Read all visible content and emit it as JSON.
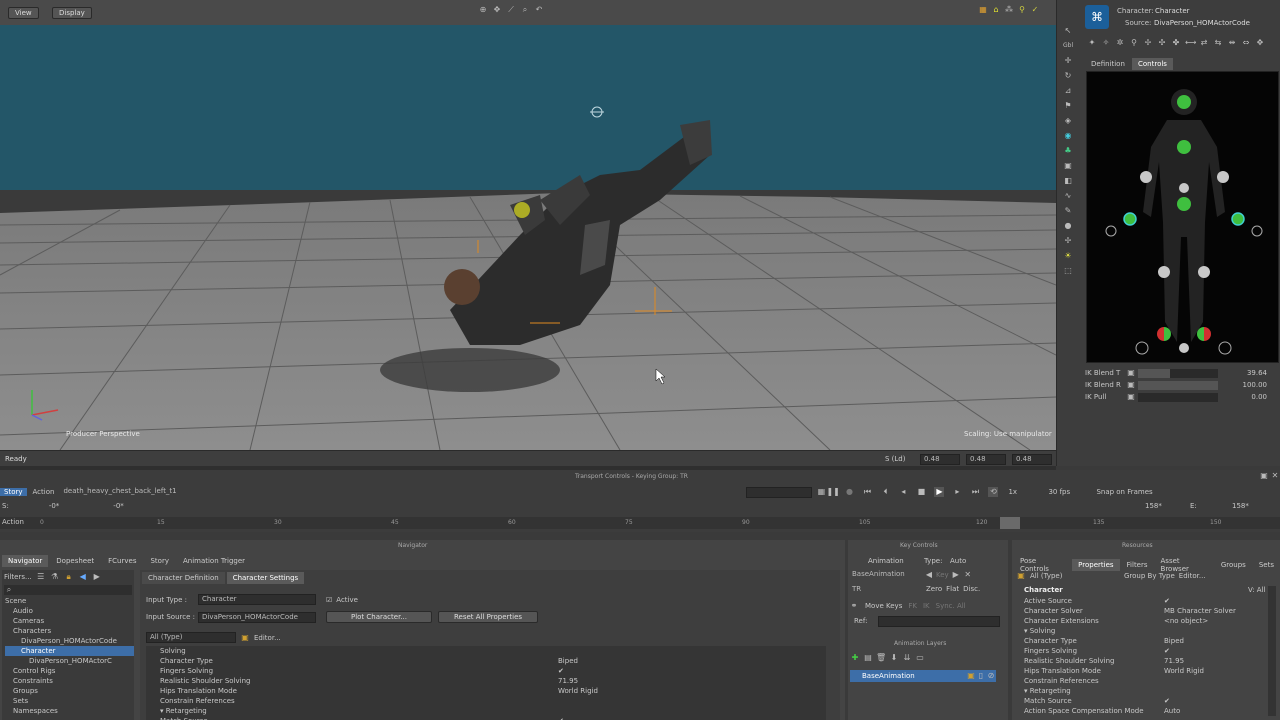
{
  "viewer": {
    "menu_view": "View",
    "menu_display": "Display",
    "label_producer": "Producer Perspective",
    "label_scaling": "Scaling: Use manipulator",
    "status_ready": "Ready",
    "status_coords": "S (Ld)",
    "coord_a": "0.48",
    "coord_b": "0.48",
    "coord_c": "0.48"
  },
  "character_panel": {
    "character_label": "Character:",
    "character_value": "Character",
    "source_label": "Source:",
    "source_value": "DivaPerson_HOMActorCode",
    "tab_definition": "Definition",
    "tab_controls": "Controls",
    "ik_rows": [
      {
        "label": "IK Blend T",
        "value": "39.64",
        "fill": 0.4
      },
      {
        "label": "IK Blend R",
        "value": "100.00",
        "fill": 1.0
      },
      {
        "label": "IK Pull",
        "value": "0.00",
        "fill": 0.0
      }
    ]
  },
  "transport": {
    "title": "Transport Controls  -  Keying Group: TR",
    "story": "Story",
    "action": "Action",
    "take": "death_heavy_chest_back_left_t1",
    "speed": "1x",
    "fps": "30 fps",
    "snap": "Snap on Frames",
    "start_label": "S:",
    "start_value": "-0*",
    "start_value2": "-0*",
    "end_label": "E:",
    "end_value": "158*",
    "end_value_left": "158*",
    "action_label": "Action",
    "ticks": [
      "0",
      "15",
      "30",
      "45",
      "60",
      "75",
      "90",
      "105",
      "120",
      "135",
      "150"
    ]
  },
  "navigator": {
    "title": "Navigator",
    "tabs": [
      "Navigator",
      "Dopesheet",
      "FCurves",
      "Story",
      "Animation Trigger"
    ],
    "filters": "Filters...",
    "tree": [
      {
        "label": "Scene",
        "indent": 0
      },
      {
        "label": "Audio",
        "indent": 1
      },
      {
        "label": "Cameras",
        "indent": 1
      },
      {
        "label": "Characters",
        "indent": 1
      },
      {
        "label": "DivaPerson_HOMActorCode",
        "indent": 2
      },
      {
        "label": "Character",
        "indent": 2
      },
      {
        "label": "DivaPerson_HOMActorC",
        "indent": 3
      },
      {
        "label": "Control Rigs",
        "indent": 1
      },
      {
        "label": "Constraints",
        "indent": 1
      },
      {
        "label": "Groups",
        "indent": 1
      },
      {
        "label": "Sets",
        "indent": 1
      },
      {
        "label": "Namespaces",
        "indent": 1
      }
    ],
    "subtabs": [
      "Character Definition",
      "Character Settings"
    ],
    "input_type_label": "Input Type :",
    "input_type_value": "Character",
    "active_label": "Active",
    "input_source_label": "Input Source :",
    "input_source_value": "DivaPerson_HOMActorCode",
    "plot_button": "Plot Character...",
    "reset_button": "Reset All Properties",
    "all_type": "All (Type)",
    "editor": "Editor...",
    "props": [
      {
        "name": "Solving",
        "value": ""
      },
      {
        "name": "Character Type",
        "value": "Biped"
      },
      {
        "name": "Fingers Solving",
        "value": "✔"
      },
      {
        "name": "Realistic Shoulder Solving",
        "value": "71.95"
      },
      {
        "name": "Hips Translation Mode",
        "value": "World Rigid"
      },
      {
        "name": "Constrain References",
        "value": ""
      },
      {
        "name": "▾ Retargeting",
        "value": ""
      },
      {
        "name": "Match Source",
        "value": "✔"
      }
    ]
  },
  "key_controls": {
    "title": "Key Controls",
    "tab_animation": "Animation",
    "type_label": "Type:",
    "type_value": "Auto",
    "layer": "BaseAnimation",
    "key_label": "Key",
    "tr": "TR",
    "zero": "Zero",
    "flat": "Flat",
    "disc": "Disc.",
    "move_keys": "Move Keys",
    "fk": "FK",
    "ik": "IK",
    "sync_all": "Sync. All",
    "ref": "Ref:",
    "layers_title": "Animation Layers",
    "base_layer": "BaseAnimation"
  },
  "resources": {
    "title": "Resources",
    "tabs": [
      "Pose Controls",
      "Properties",
      "Filters",
      "Asset Browser",
      "Groups",
      "Sets"
    ],
    "all_type": "All (Type)",
    "group_by": "Group By Type",
    "editor": "Editor...",
    "v_all": "V: All",
    "header": "Character",
    "props": [
      {
        "name": "Active Source",
        "value": "✔"
      },
      {
        "name": "Character Solver",
        "value": "MB Character Solver"
      },
      {
        "name": "Character Extensions",
        "value": "<no object>"
      },
      {
        "name": "▾ Solving",
        "value": ""
      },
      {
        "name": "Character Type",
        "value": "Biped"
      },
      {
        "name": "Fingers Solving",
        "value": "✔"
      },
      {
        "name": "Realistic Shoulder Solving",
        "value": "71.95"
      },
      {
        "name": "Hips Translation Mode",
        "value": "World Rigid"
      },
      {
        "name": "Constrain References",
        "value": ""
      },
      {
        "name": "▾ Retargeting",
        "value": ""
      },
      {
        "name": "Match Source",
        "value": "✔"
      },
      {
        "name": "Action Space Compensation Mode",
        "value": "Auto"
      }
    ]
  }
}
